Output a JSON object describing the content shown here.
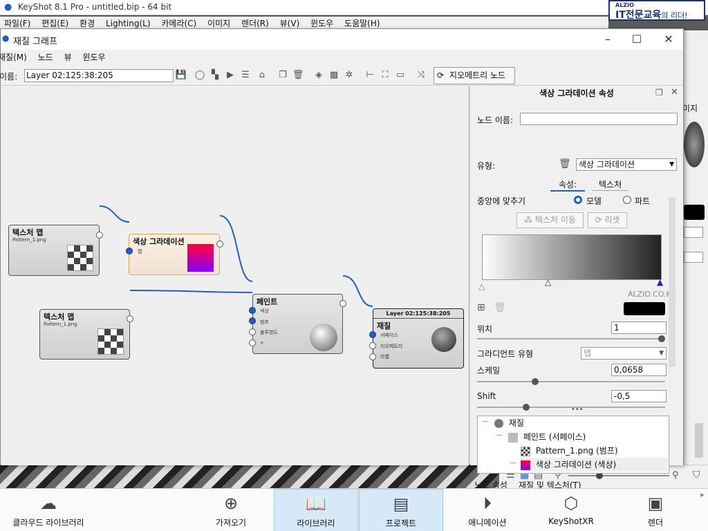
{
  "app": {
    "title": "KeyShot 8.1 Pro  - untitled.bip  - 64 bit",
    "menu": [
      "파일(F)",
      "편집(E)",
      "환경",
      "Lighting(L)",
      "카메라(C)",
      "이미지",
      "렌더(R)",
      "뷰(V)",
      "윈도우",
      "도움말(H)"
    ]
  },
  "logo": {
    "small": "ALZIO",
    "big": "IT전문교육",
    "suffix": "의 리더!"
  },
  "bg_right": {
    "label": "미지"
  },
  "window": {
    "title": "재질 그래프",
    "menu": [
      "재질(M)",
      "노드",
      "뷰",
      "윈도우"
    ],
    "name_label": "이름:",
    "name_value": "Layer 02:125:38:205",
    "geometry_button": "지오메트리 노드"
  },
  "nodes": {
    "tex1": {
      "title": "텍스처 맵",
      "sub": "Pattern_1.png"
    },
    "grad": {
      "title": "색상 그라데이션",
      "input": "맵"
    },
    "tex2": {
      "title": "텍스처 맵",
      "sub": "Pattern_1.png"
    },
    "paint": {
      "title": "페인트",
      "inputs": [
        "색상",
        "범프",
        "불투명도",
        "+"
      ]
    },
    "material": {
      "header": "Layer 02:125:38:205",
      "title": "재질",
      "inputs": [
        "서페이스",
        "지오메트리",
        "라벨"
      ]
    }
  },
  "panel": {
    "title": "색상 그라데이션 속성",
    "node_name_label": "노드 이름:",
    "node_name_value": "",
    "type_label": "유형:",
    "type_value": "색상 그라데이션",
    "tabs": [
      "속성:",
      "텍스처"
    ],
    "center_label": "중앙에 맞추기",
    "radio_model": "모델",
    "radio_part": "파트",
    "btn_move": "텍스처 이동",
    "btn_reset": "리셋",
    "watermark": "ALZIO.CO.KR",
    "position_label": "위치",
    "position_value": "1",
    "position_fraction": 1,
    "gradtype_label": "그라디언트 유형",
    "gradtype_value": "맵",
    "scale_label": "스케일",
    "scale_value": "0,0658",
    "scale_fraction": 0.3,
    "shift_label": "Shift",
    "shift_value": "-0,5",
    "shift_fraction": 0.25,
    "tree": [
      "재질",
      "페인트 (서페이스)",
      "Pattern_1.png (범프)",
      "색상 그라데이션 (색상)"
    ],
    "bottom_tabs": [
      "노드 속성",
      "재질 및 텍스처(T)"
    ]
  },
  "dock": [
    "클라우드 라이브러리",
    "가져오기",
    "라이브러리",
    "프로젝트",
    "애니메이션",
    "KeyShotXR",
    "렌더"
  ],
  "colors": {
    "accent": "#1e5fc0",
    "gradient_node_border": "#e8a060",
    "dock_selected": "#d6e9f8"
  }
}
